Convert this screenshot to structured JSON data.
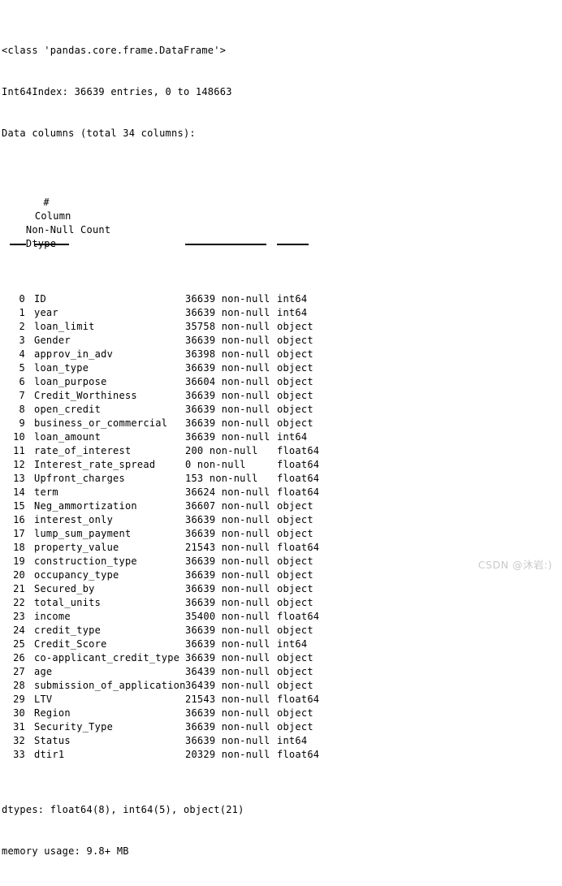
{
  "output": {
    "class_line": "<class 'pandas.core.frame.DataFrame'>",
    "index_line": "Int64Index: 36639 entries, 0 to 148663",
    "columns_line": "Data columns (total 34 columns):",
    "dtypes_line": "dtypes: float64(8), int64(5), object(21)",
    "memory_line": "memory usage: 9.8+ MB"
  },
  "table": {
    "headers": {
      "index": "#",
      "column": "Column",
      "count": "Non-Null Count",
      "dtype": "Dtype"
    },
    "rows": [
      {
        "index": "0",
        "column": "ID",
        "count": "36639 non-null",
        "dtype": "int64"
      },
      {
        "index": "1",
        "column": "year",
        "count": "36639 non-null",
        "dtype": "int64"
      },
      {
        "index": "2",
        "column": "loan_limit",
        "count": "35758 non-null",
        "dtype": "object"
      },
      {
        "index": "3",
        "column": "Gender",
        "count": "36639 non-null",
        "dtype": "object"
      },
      {
        "index": "4",
        "column": "approv_in_adv",
        "count": "36398 non-null",
        "dtype": "object"
      },
      {
        "index": "5",
        "column": "loan_type",
        "count": "36639 non-null",
        "dtype": "object"
      },
      {
        "index": "6",
        "column": "loan_purpose",
        "count": "36604 non-null",
        "dtype": "object"
      },
      {
        "index": "7",
        "column": "Credit_Worthiness",
        "count": "36639 non-null",
        "dtype": "object"
      },
      {
        "index": "8",
        "column": "open_credit",
        "count": "36639 non-null",
        "dtype": "object"
      },
      {
        "index": "9",
        "column": "business_or_commercial",
        "count": "36639 non-null",
        "dtype": "object"
      },
      {
        "index": "10",
        "column": "loan_amount",
        "count": "36639 non-null",
        "dtype": "int64"
      },
      {
        "index": "11",
        "column": "rate_of_interest",
        "count": "200 non-null",
        "dtype": "float64"
      },
      {
        "index": "12",
        "column": "Interest_rate_spread",
        "count": "0 non-null",
        "dtype": "float64"
      },
      {
        "index": "13",
        "column": "Upfront_charges",
        "count": "153 non-null",
        "dtype": "float64"
      },
      {
        "index": "14",
        "column": "term",
        "count": "36624 non-null",
        "dtype": "float64"
      },
      {
        "index": "15",
        "column": "Neg_ammortization",
        "count": "36607 non-null",
        "dtype": "object"
      },
      {
        "index": "16",
        "column": "interest_only",
        "count": "36639 non-null",
        "dtype": "object"
      },
      {
        "index": "17",
        "column": "lump_sum_payment",
        "count": "36639 non-null",
        "dtype": "object"
      },
      {
        "index": "18",
        "column": "property_value",
        "count": "21543 non-null",
        "dtype": "float64"
      },
      {
        "index": "19",
        "column": "construction_type",
        "count": "36639 non-null",
        "dtype": "object"
      },
      {
        "index": "20",
        "column": "occupancy_type",
        "count": "36639 non-null",
        "dtype": "object"
      },
      {
        "index": "21",
        "column": "Secured_by",
        "count": "36639 non-null",
        "dtype": "object"
      },
      {
        "index": "22",
        "column": "total_units",
        "count": "36639 non-null",
        "dtype": "object"
      },
      {
        "index": "23",
        "column": "income",
        "count": "35400 non-null",
        "dtype": "float64"
      },
      {
        "index": "24",
        "column": "credit_type",
        "count": "36639 non-null",
        "dtype": "object"
      },
      {
        "index": "25",
        "column": "Credit_Score",
        "count": "36639 non-null",
        "dtype": "int64"
      },
      {
        "index": "26",
        "column": "co-applicant_credit_type",
        "count": "36639 non-null",
        "dtype": "object"
      },
      {
        "index": "27",
        "column": "age",
        "count": "36439 non-null",
        "dtype": "object"
      },
      {
        "index": "28",
        "column": "submission_of_application",
        "count": "36439 non-null",
        "dtype": "object"
      },
      {
        "index": "29",
        "column": "LTV",
        "count": "21543 non-null",
        "dtype": "float64"
      },
      {
        "index": "30",
        "column": "Region",
        "count": "36639 non-null",
        "dtype": "object"
      },
      {
        "index": "31",
        "column": "Security_Type",
        "count": "36639 non-null",
        "dtype": "object"
      },
      {
        "index": "32",
        "column": "Status",
        "count": "36639 non-null",
        "dtype": "int64"
      },
      {
        "index": "33",
        "column": "dtir1",
        "count": "20329 non-null",
        "dtype": "float64"
      }
    ]
  },
  "watermark": {
    "text": "CSDN @沐岩:)",
    "color": "#c9c9c9"
  }
}
